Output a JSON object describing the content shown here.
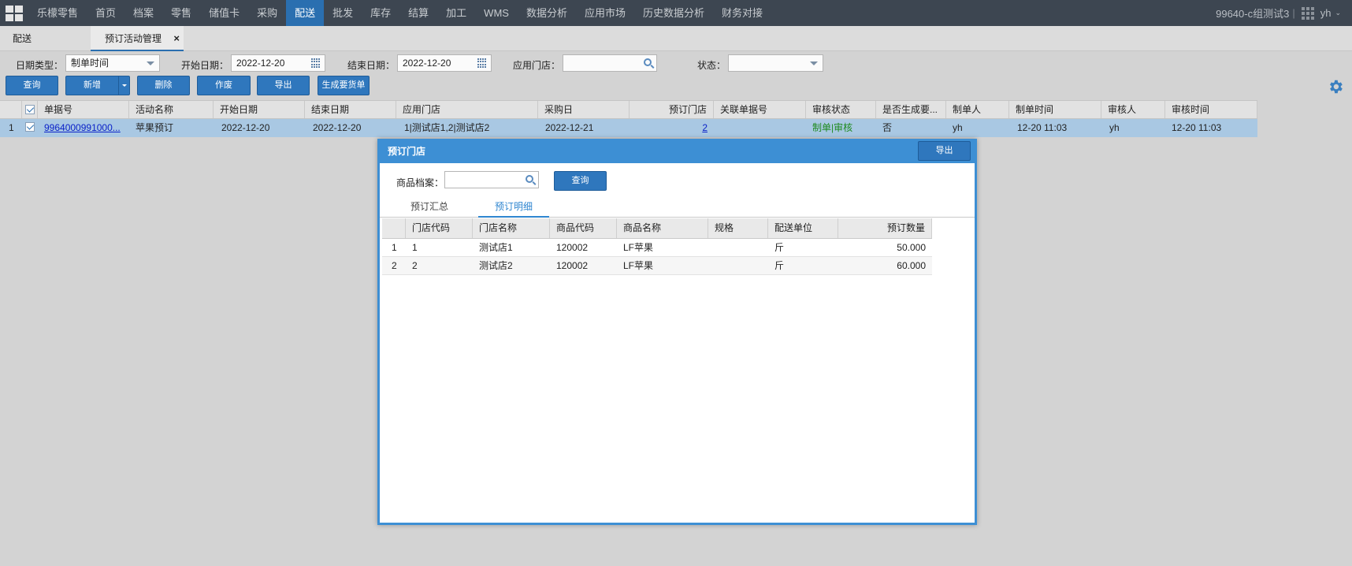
{
  "nav": {
    "items": [
      "乐檬零售",
      "首页",
      "档案",
      "零售",
      "储值卡",
      "采购",
      "配送",
      "批发",
      "库存",
      "结算",
      "加工",
      "WMS",
      "数据分析",
      "应用市场",
      "历史数据分析",
      "财务对接"
    ],
    "active": "配送",
    "org": "99640-c组测试3",
    "user": "yh"
  },
  "tabs": {
    "tab1": "配送",
    "tab2": "预订活动管理"
  },
  "filters": {
    "date_type_label": "日期类型：",
    "date_type_value": "制单时间",
    "start_label": "开始日期：",
    "start_value": "2022-12-20",
    "end_label": "结束日期：",
    "end_value": "2022-12-20",
    "store_label": "应用门店：",
    "store_value": "",
    "status_label": "状态：",
    "status_value": ""
  },
  "buttons": {
    "query": "查询",
    "add": "新增",
    "delete": "删除",
    "void": "作废",
    "export": "导出",
    "generate": "生成要货单"
  },
  "grid": {
    "headers": [
      "单据号",
      "活动名称",
      "开始日期",
      "结束日期",
      "应用门店",
      "采购日",
      "预订门店",
      "关联单据号",
      "审核状态",
      "是否生成要...",
      "制单人",
      "制单时间",
      "审核人",
      "审核时间"
    ],
    "rows": [
      {
        "index": "1",
        "doc_no": "9964000991000...",
        "activity": "苹果预订",
        "start": "2022-12-20",
        "end": "2022-12-20",
        "stores": "1|测试店1,2|测试店2",
        "purchase_day": "2022-12-21",
        "order_stores": "2",
        "related": "",
        "audit_status": "制单|审核",
        "generated": "否",
        "maker": "yh",
        "make_time": "12-20 11:03",
        "auditor": "yh",
        "audit_time": "12-20 11:03"
      }
    ]
  },
  "modal": {
    "title": "预订门店",
    "filter_label": "商品档案：",
    "filter_value": "",
    "query": "查询",
    "tabs": [
      "预订汇总",
      "预订明细"
    ],
    "active_tab": "预订明细",
    "headers": [
      "门店代码",
      "门店名称",
      "商品代码",
      "商品名称",
      "规格",
      "配送单位",
      "预订数量"
    ],
    "rows": [
      {
        "index": "1",
        "store_code": "1",
        "store_name": "测试店1",
        "product_code": "120002",
        "product_name": "LF苹果",
        "spec": "",
        "unit": "斤",
        "qty": "50.000"
      },
      {
        "index": "2",
        "store_code": "2",
        "store_name": "测试店2",
        "product_code": "120002",
        "product_name": "LF苹果",
        "spec": "",
        "unit": "斤",
        "qty": "60.000"
      }
    ],
    "export": "导出"
  }
}
